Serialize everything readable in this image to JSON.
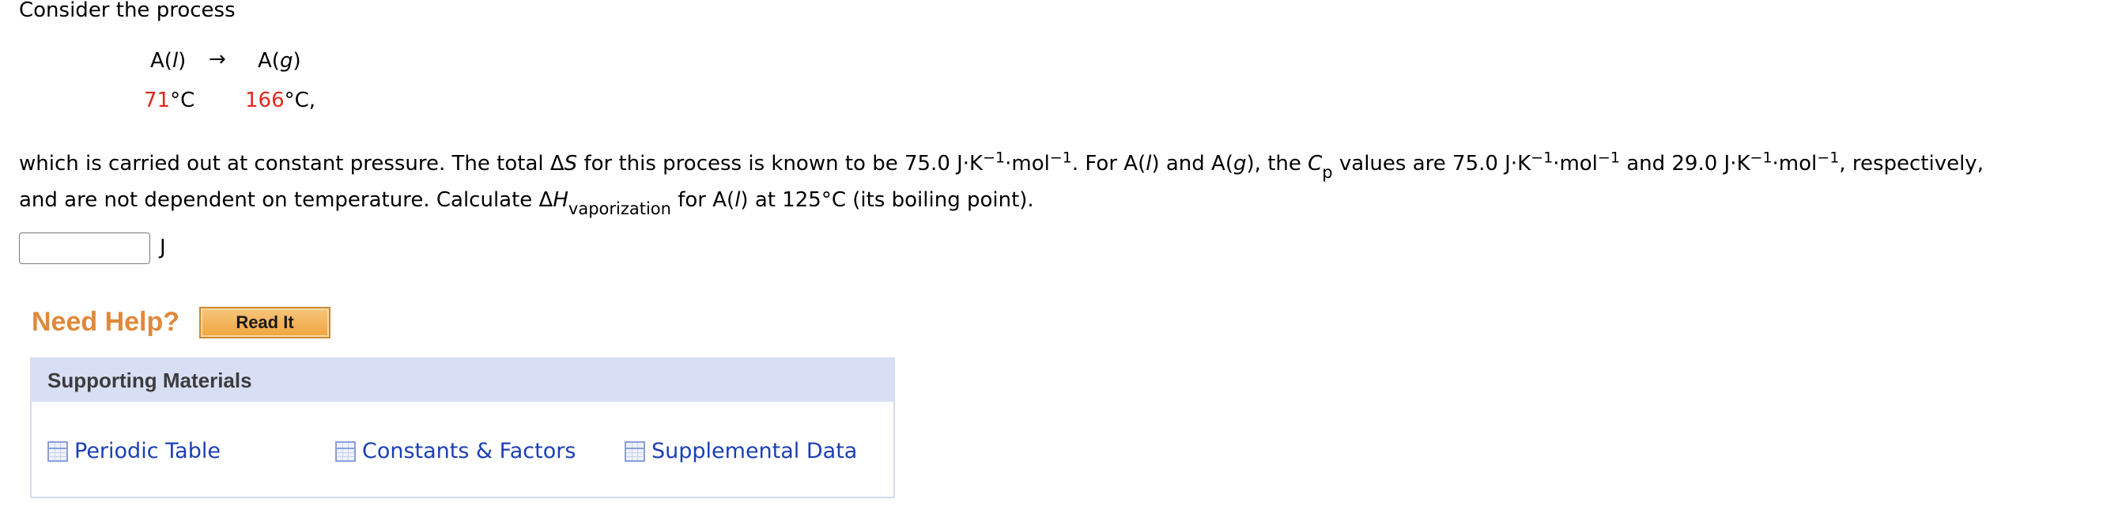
{
  "question": {
    "intro": "Consider the process",
    "reaction": {
      "reactant": "A(",
      "reactant_phase": "l",
      "reactant_close": ")",
      "arrow": "→",
      "product": "A(",
      "product_phase": "g",
      "product_close": ")",
      "temp1_value": "71",
      "temp1_unit": "°C",
      "temp2_value": "166",
      "temp2_unit": "°C,"
    },
    "line1": {
      "a": "which is carried out at constant pressure. The total Δ",
      "a_ital": "S",
      "b": " for this process is known to be 75.0 J·K",
      "b_sup": "−1",
      "c": "·mol",
      "c_sup": "−1",
      "d": ". For A(",
      "d_ital": "l",
      "e": ") and A(",
      "e_ital": "g",
      "f": "), the ",
      "f_ital": "C",
      "f_sub": "p",
      "g": " values are 75.0 J·K",
      "g_sup": "−1",
      "h": "·mol",
      "h_sup": "−1",
      "i": " and 29.0 J·K",
      "i_sup": "−1",
      "j": "·mol",
      "j_sup": "−1",
      "k": ", respectively,"
    },
    "line2": {
      "a": "and are not dependent on temperature. Calculate Δ",
      "a_ital": "H",
      "a_sub": "vaporization",
      "b": " for A(",
      "b_ital": "l",
      "c": ") at 125°C (its boiling point)."
    },
    "answer": {
      "value": "",
      "unit": "J"
    }
  },
  "help": {
    "title": "Need Help?",
    "read_it": "Read It"
  },
  "supporting": {
    "title": "Supporting Materials",
    "links": [
      {
        "label": "Periodic Table",
        "icon": "table-icon"
      },
      {
        "label": "Constants & Factors",
        "icon": "table-icon"
      },
      {
        "label": "Supplemental Data",
        "icon": "table-icon"
      }
    ]
  },
  "colors": {
    "temperature": "#e3261e",
    "need_help": "#e0893a",
    "link": "#1b3fb5",
    "panel_header": "#d8def4"
  }
}
